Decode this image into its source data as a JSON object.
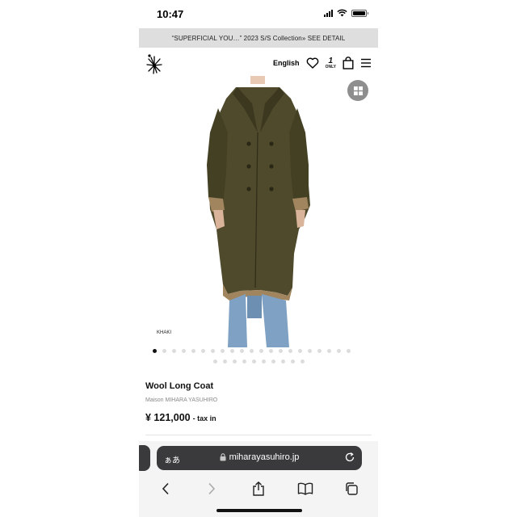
{
  "status_bar": {
    "time": "10:47"
  },
  "announcement": {
    "text": "“SUPERFICIAL YOU…” 2023 S/S Collection» SEE DETAIL"
  },
  "header": {
    "language_label": "English",
    "only_badge": {
      "number": "1",
      "text": "ONLY"
    },
    "icons": [
      "logo-icon",
      "heart-icon",
      "only-badge-icon",
      "bag-icon",
      "menu-icon"
    ]
  },
  "gallery": {
    "color_caption": "KHAKI",
    "total_images": 31,
    "active_index": 0,
    "grid_icon": "grid-icon"
  },
  "product": {
    "name": "Wool Long Coat",
    "brand": "Maison MIHARA YASUHIRO",
    "price": "¥ 121,000",
    "tax_note": "- tax in"
  },
  "browser": {
    "text_size_label": "ぁあ",
    "url": "miharayasuhiro.jp",
    "icons": [
      "lock-icon",
      "reload-icon",
      "back-icon",
      "forward-icon",
      "share-icon",
      "bookmarks-icon",
      "tabs-icon"
    ]
  },
  "colors": {
    "coat": "#4f4a2c",
    "announce_bg": "#dedede",
    "url_bar_bg": "#3a3a3c"
  }
}
